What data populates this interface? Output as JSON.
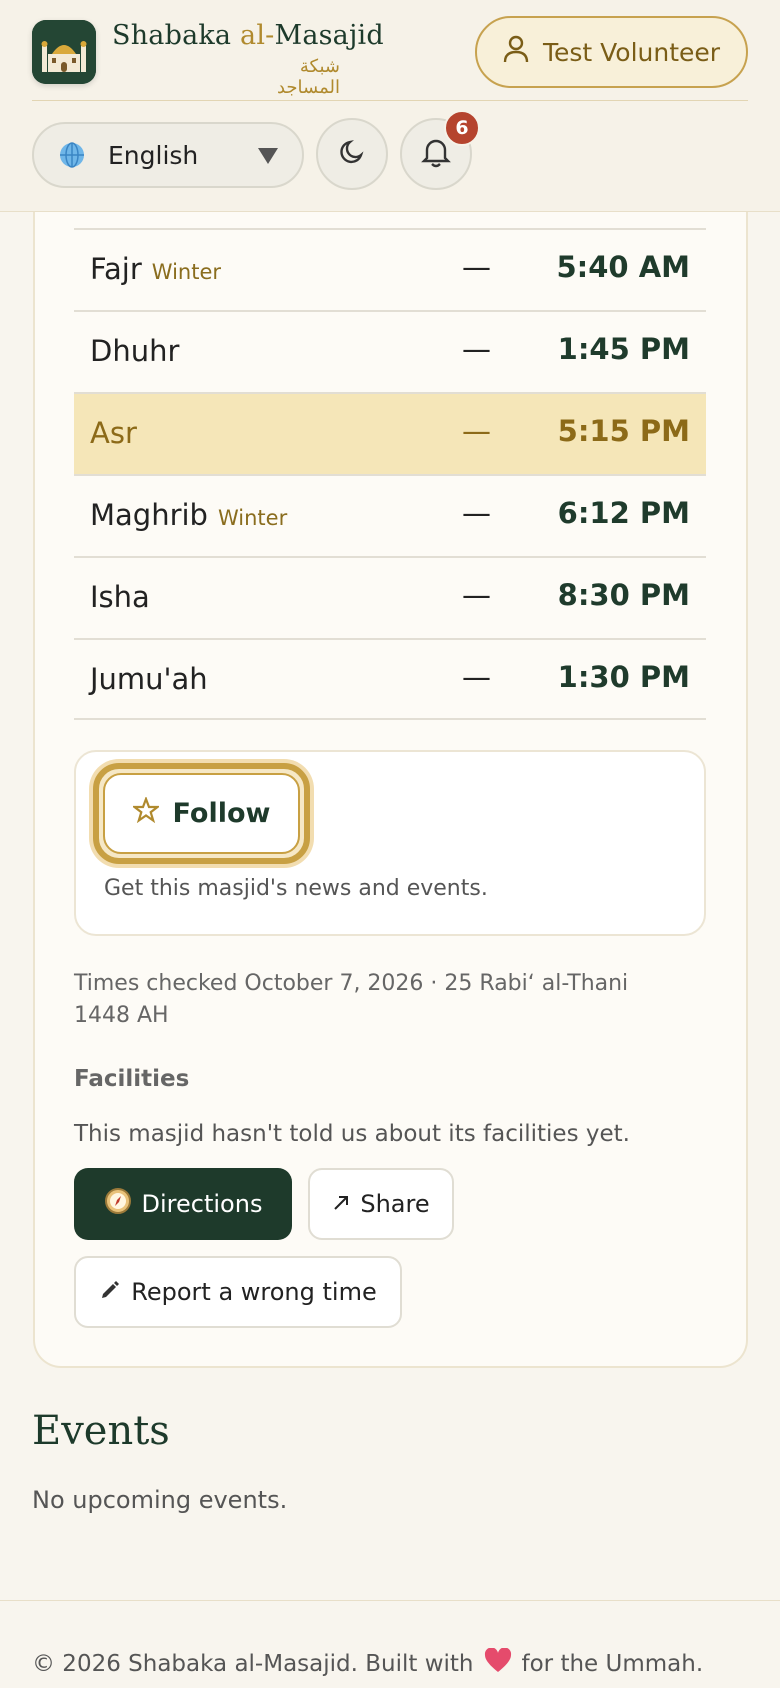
{
  "header": {
    "brand_prefix": "Shabaka ",
    "brand_accent": "al-",
    "brand_suffix": "Masajid",
    "brand_arabic": "شبكة المساجد",
    "user_label": "Test Volunteer",
    "language": "English",
    "notification_count": "6"
  },
  "prayers": [
    {
      "name": "Fajr",
      "season": "Winter",
      "dash": "—",
      "time": "5:40 AM"
    },
    {
      "name": "Dhuhr",
      "season": "",
      "dash": "—",
      "time": "1:45 PM"
    },
    {
      "name": "Asr",
      "season": "",
      "dash": "—",
      "time": "5:15 PM"
    },
    {
      "name": "Maghrib",
      "season": "Winter",
      "dash": "—",
      "time": "6:12 PM"
    },
    {
      "name": "Isha",
      "season": "",
      "dash": "—",
      "time": "8:30 PM"
    },
    {
      "name": "Jumu'ah",
      "season": "",
      "dash": "—",
      "time": "1:30 PM"
    }
  ],
  "follow": {
    "label": "Follow",
    "description": "Get this masjid's news and events."
  },
  "checked_note": "Times checked October 7, 2026 · 25 Rabiʻ al-Thani 1448 AH",
  "facilities": {
    "heading": "Facilities",
    "text": "This masjid hasn't told us about its facilities yet."
  },
  "actions": {
    "directions": "Directions",
    "share": "Share",
    "report": "Report a wrong time"
  },
  "events": {
    "heading": "Events",
    "empty": "No upcoming events."
  },
  "footer": {
    "left": "© 2026 Shabaka al-Masajid. Built with",
    "right": "for the Ummah."
  },
  "colors": {
    "primary": "#1e3a2b",
    "accent_gold": "#c8a043",
    "highlight_row": "#f5e6b8",
    "badge": "#b5442e"
  }
}
